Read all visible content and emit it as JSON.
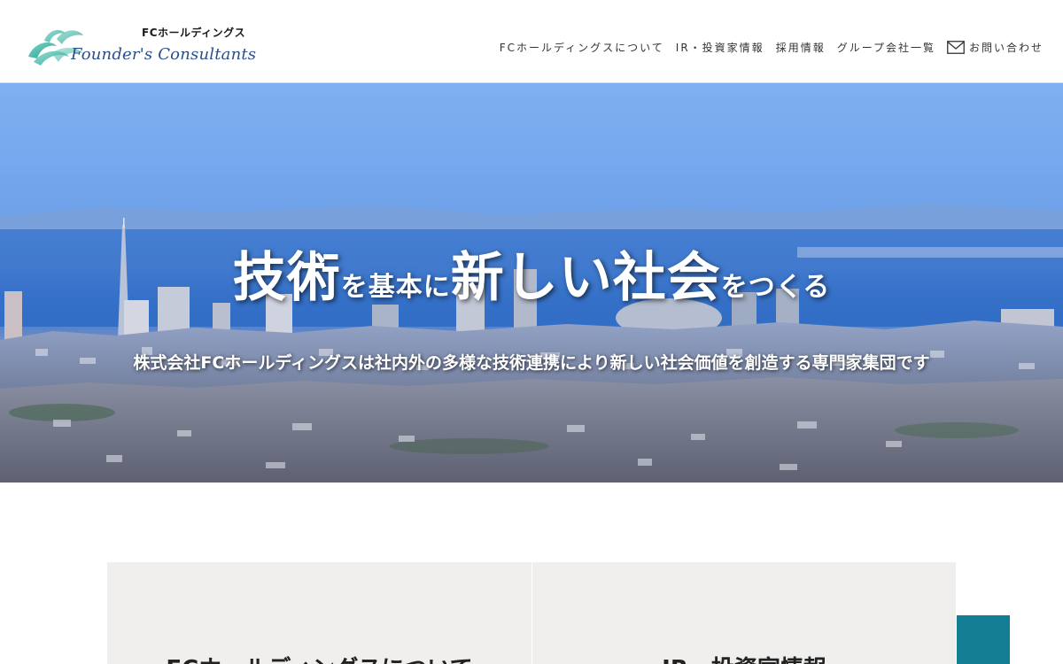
{
  "header": {
    "logo": {
      "jp": "FCホールディングス",
      "en": "Founder's Consultants",
      "icon": "swirl-logo-icon"
    },
    "nav": [
      {
        "label": "FCホールディングスについて"
      },
      {
        "label": "IR・投資家情報"
      },
      {
        "label": "採用情報"
      },
      {
        "label": "グループ会社一覧"
      },
      {
        "label": "お問い合わせ",
        "icon": "mail-icon"
      }
    ]
  },
  "hero": {
    "title": {
      "part1": "技術",
      "part2": "を基本に",
      "part3": "新しい社会",
      "part4": "をつくる"
    },
    "subtitle": "株式会社FCホールディングスは社内外の多様な技術連携により新しい社会価値を創造する専門家集団です"
  },
  "cards": [
    {
      "title": "FCホールディングスについて"
    },
    {
      "title": "IR・投資家情報"
    }
  ],
  "colors": {
    "accent": "#137e93",
    "card_bg": "#f0efed",
    "logo_teal": "#2bb3a3",
    "logo_blue": "#2a4f8a"
  }
}
